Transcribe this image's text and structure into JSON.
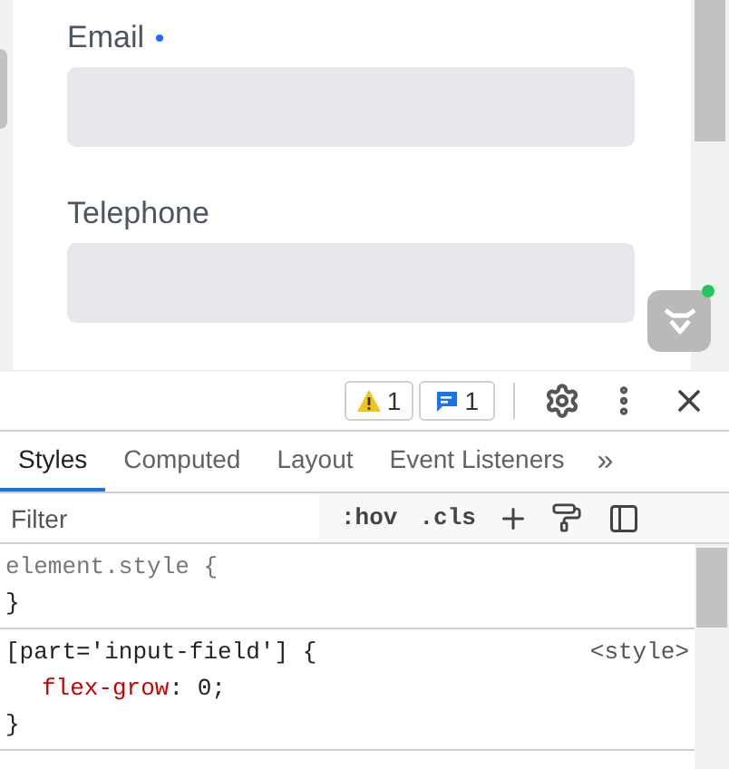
{
  "form": {
    "fields": [
      {
        "label": "Email",
        "required": true
      },
      {
        "label": "Telephone",
        "required": false
      }
    ]
  },
  "dev_badge": {
    "online": true
  },
  "devtools": {
    "toolbar": {
      "warnings": "1",
      "messages": "1"
    },
    "tabs": [
      {
        "label": "Styles",
        "selected": true
      },
      {
        "label": "Computed",
        "selected": false
      },
      {
        "label": "Layout",
        "selected": false
      },
      {
        "label": "Event Listeners",
        "selected": false
      }
    ],
    "more_tabs": "»",
    "filter": {
      "placeholder": "Filter"
    },
    "filter_buttons": [
      ":hov",
      ".cls"
    ],
    "rules": [
      {
        "selector": "element.style {",
        "closing": "}"
      },
      {
        "selector": "[part='input-field'] {",
        "source": "<style>",
        "declarations": [
          {
            "property": "flex-grow",
            "rest": ": 0;"
          }
        ],
        "closing": "}"
      }
    ]
  }
}
